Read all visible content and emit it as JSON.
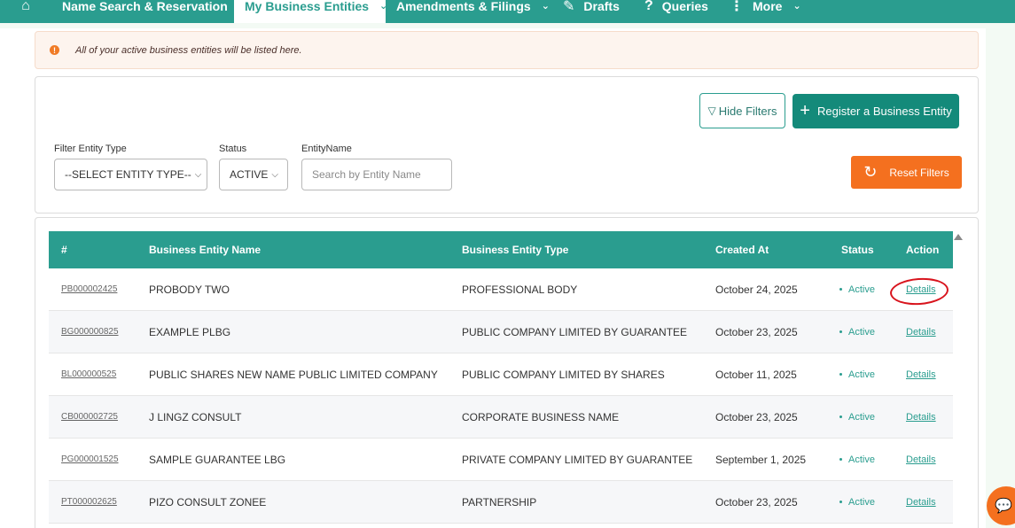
{
  "nav": {
    "items": [
      {
        "label": "Name Search & Reservation",
        "has_dropdown": true
      },
      {
        "label": "My Business Entities",
        "has_dropdown": true,
        "active": true
      },
      {
        "label": "Amendments & Filings",
        "has_dropdown": true
      },
      {
        "label": "Drafts"
      },
      {
        "label": "Queries"
      },
      {
        "label": "More",
        "has_dropdown": true
      }
    ]
  },
  "alert": {
    "message": "All of your active business entities will be listed here."
  },
  "filters": {
    "hide_filters_label": "Hide Filters",
    "register_label": "Register a Business Entity",
    "reset_label": "Reset Filters",
    "entity_type_label": "Filter Entity Type",
    "entity_type_value": "--SELECT ENTITY TYPE--",
    "status_label": "Status",
    "status_value": "ACTIVE",
    "entity_name_label": "EntityName",
    "entity_name_placeholder": "Search by Entity Name"
  },
  "table": {
    "headers": [
      "#",
      "Business Entity Name",
      "Business Entity Type",
      "Created At",
      "Status",
      "Action"
    ],
    "rows": [
      {
        "id": "PB000002425",
        "name": "PROBODY TWO",
        "type": "PROFESSIONAL BODY",
        "created": "October 24, 2025",
        "status": "Active",
        "action": "Details"
      },
      {
        "id": "BG000000825",
        "name": "EXAMPLE PLBG",
        "type": "PUBLIC COMPANY LIMITED BY GUARANTEE",
        "created": "October 23, 2025",
        "status": "Active",
        "action": "Details"
      },
      {
        "id": "BL000000525",
        "name": "PUBLIC SHARES NEW NAME PUBLIC LIMITED COMPANY",
        "type": "PUBLIC COMPANY LIMITED BY SHARES",
        "created": "October 11, 2025",
        "status": "Active",
        "action": "Details"
      },
      {
        "id": "CB000002725",
        "name": "J LINGZ CONSULT",
        "type": "CORPORATE BUSINESS NAME",
        "created": "October 23, 2025",
        "status": "Active",
        "action": "Details"
      },
      {
        "id": "PG000001525",
        "name": "SAMPLE GUARANTEE LBG",
        "type": "PRIVATE COMPANY LIMITED BY GUARANTEE",
        "created": "September 1, 2025",
        "status": "Active",
        "action": "Details"
      },
      {
        "id": "PT000002625",
        "name": "PIZO CONSULT ZONEE",
        "type": "PARTNERSHIP",
        "created": "October 23, 2025",
        "status": "Active",
        "action": "Details"
      }
    ]
  },
  "colors": {
    "primary": "#2a9d8f",
    "accent": "#f4701f",
    "annotation": "#d8141d"
  }
}
